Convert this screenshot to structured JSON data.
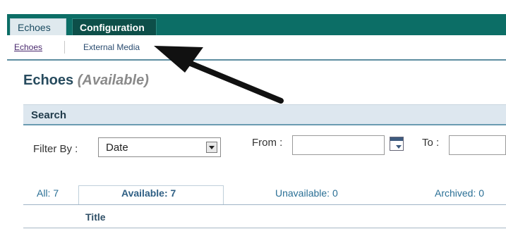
{
  "tabs": {
    "echoes": "Echoes",
    "configuration": "Configuration"
  },
  "subnav": {
    "echoes": "Echoes",
    "external_media": "External Media"
  },
  "page": {
    "title": "Echoes",
    "title_suffix": "(Available)"
  },
  "search": {
    "heading": "Search",
    "filter_by_label": "Filter By :",
    "filter_value": "Date",
    "from_label": "From :",
    "to_label": "To :",
    "from_value": "",
    "to_value": ""
  },
  "status_tabs": {
    "all": "All: 7",
    "available": "Available: 7",
    "unavailable": "Unavailable: 0",
    "archived": "Archived: 0"
  },
  "table": {
    "col_title": "Title"
  },
  "icons": {
    "calendar": "calendar-icon",
    "dropdown": "chevron-down-icon",
    "annotation": "arrow-annotation"
  },
  "colors": {
    "header_teal": "#0c6e66",
    "active_tab_dark": "#0d4f49",
    "link_blue": "#2a6f95",
    "search_band": "#dde7ef"
  }
}
